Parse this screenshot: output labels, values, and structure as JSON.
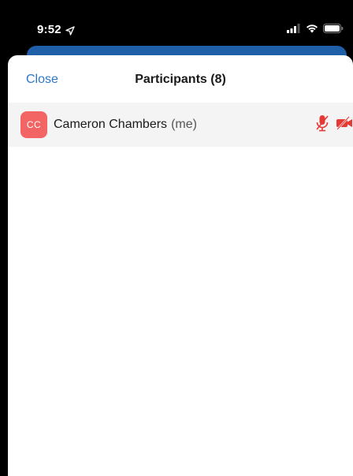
{
  "status_bar": {
    "time": "9:52",
    "icons": [
      "location-arrow-icon",
      "cellular-signal-icon",
      "wifi-icon",
      "battery-icon"
    ]
  },
  "sheet": {
    "close_label": "Close",
    "title": "Participants (8)"
  },
  "participants": [
    {
      "initials": "CC",
      "name": "Cameron Chambers",
      "suffix": "(me)",
      "audio_muted": true,
      "video_off": true
    }
  ],
  "colors": {
    "accent": "#2d77c7",
    "avatar": "#f36464",
    "muted_icon": "#e53935",
    "underlay_blue": "#1f5fa8"
  }
}
